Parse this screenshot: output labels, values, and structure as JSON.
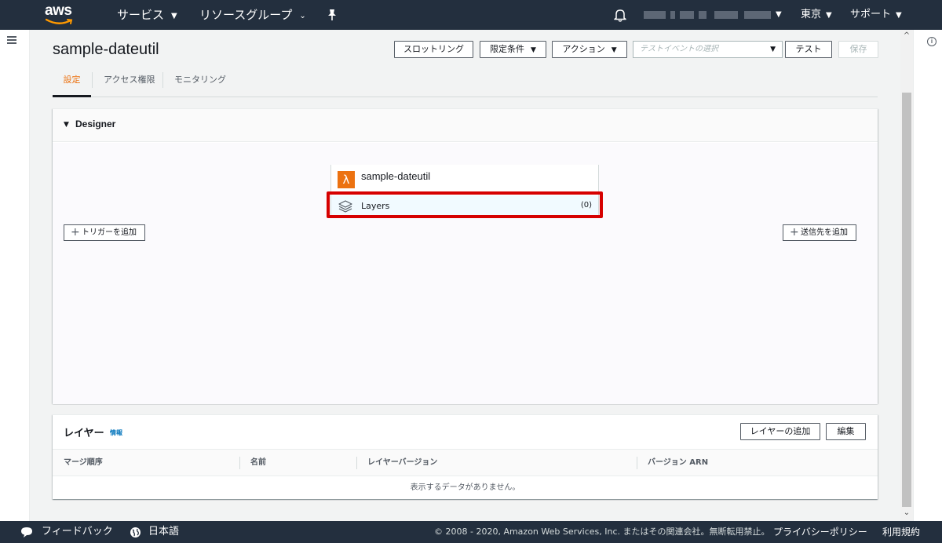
{
  "topbar": {
    "logo_text": "aws",
    "services_label": "サービス",
    "resource_groups_label": "リソースグループ",
    "region_label": "東京",
    "support_label": "サポート",
    "icons": [
      "pin-icon",
      "bell-icon",
      "chevron-down-icon"
    ]
  },
  "page": {
    "title": "sample-dateutil",
    "buttons": {
      "throttle": "スロットリング",
      "qualifiers": "限定条件",
      "actions": "アクション",
      "test_event_placeholder": "テストイベントの選択",
      "test": "テスト",
      "save": "保存"
    },
    "tabs": [
      "設定",
      "アクセス権限",
      "モニタリング"
    ],
    "active_tab": "設定"
  },
  "designer": {
    "title": "Designer",
    "function_name": "sample-dateutil",
    "layers_label": "Layers",
    "layers_count": "(0)",
    "add_trigger_label": "トリガーを追加",
    "add_destination_label": "送信先を追加"
  },
  "layers_panel": {
    "title": "レイヤー",
    "info_link": "情報",
    "add_layer_button": "レイヤーの追加",
    "edit_button": "編集",
    "columns": [
      "マージ順序",
      "名前",
      "レイヤーバージョン",
      "バージョン ARN"
    ],
    "empty_message": "表示するデータがありません。"
  },
  "footer": {
    "feedback_label": "フィードバック",
    "language_label": "日本語",
    "copyright": "© 2008 - 2020, Amazon Web Services, Inc. またはその関連会社。無断転用禁止。",
    "privacy_link": "プライバシーポリシー",
    "terms_link": "利用規約"
  },
  "colors": {
    "nav_bg": "#232f3e",
    "accent_orange": "#ec7211",
    "highlight_red": "#d60000",
    "link_blue": "#0073bb"
  }
}
